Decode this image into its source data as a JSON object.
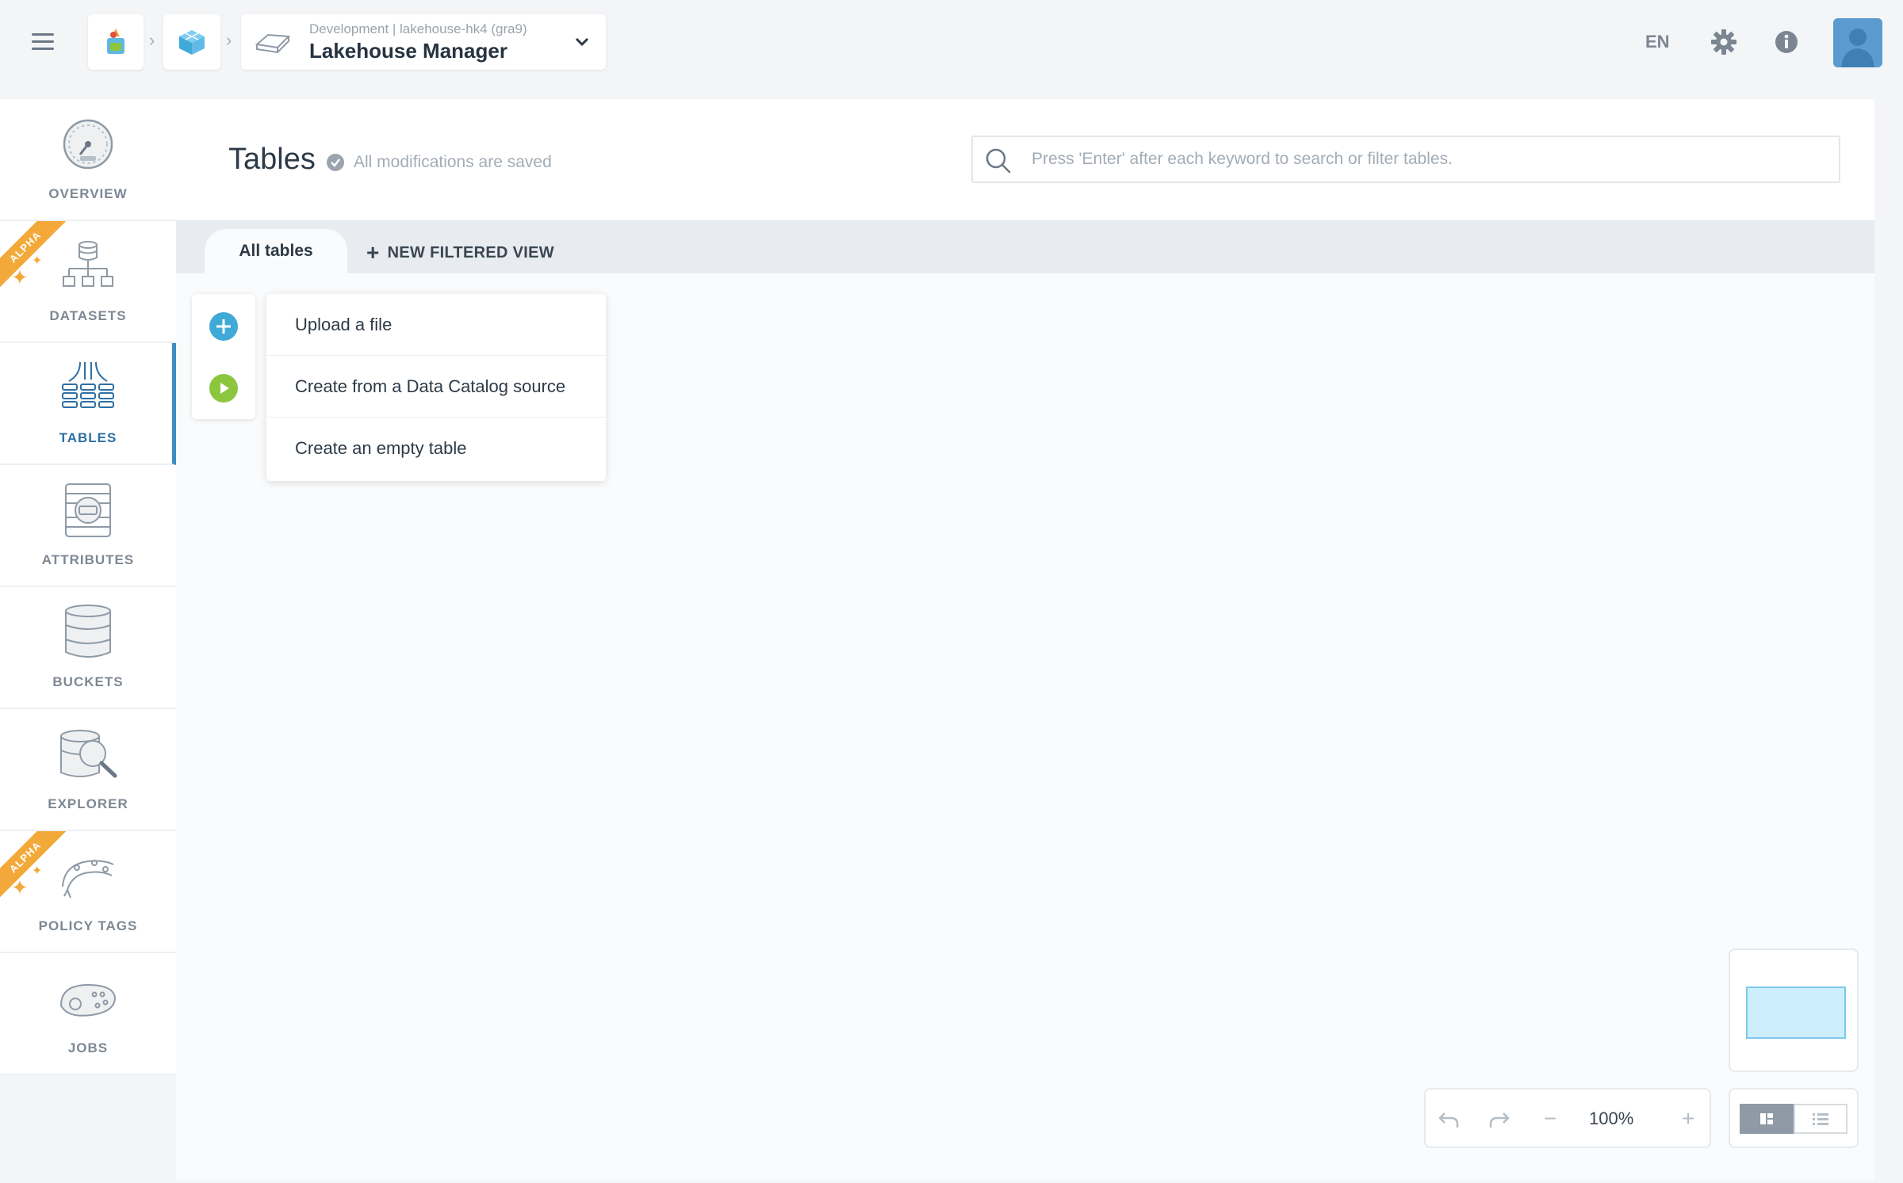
{
  "topbar": {
    "project_subtitle": "Development | lakehouse-hk4 (gra9)",
    "project_title": "Lakehouse Manager",
    "language": "EN"
  },
  "sidebar": {
    "items": [
      {
        "label": "OVERVIEW",
        "icon": "speedometer-icon",
        "alpha": false
      },
      {
        "label": "DATASETS",
        "icon": "dataset-tree-icon",
        "alpha": true
      },
      {
        "label": "TABLES",
        "icon": "tables-icon",
        "alpha": false,
        "active": true
      },
      {
        "label": "ATTRIBUTES",
        "icon": "attributes-icon",
        "alpha": false
      },
      {
        "label": "BUCKETS",
        "icon": "buckets-icon",
        "alpha": false
      },
      {
        "label": "EXPLORER",
        "icon": "explorer-icon",
        "alpha": false
      },
      {
        "label": "POLICY TAGS",
        "icon": "policy-tags-icon",
        "alpha": true
      },
      {
        "label": "JOBS",
        "icon": "jobs-icon",
        "alpha": false
      }
    ],
    "alpha_label": "ALPHA"
  },
  "main": {
    "title": "Tables",
    "saved_status": "All modifications are saved",
    "search_placeholder": "Press 'Enter' after each keyword to search or filter tables.",
    "tabs": {
      "all_tables": "All tables",
      "new_filtered_view": "NEW FILTERED VIEW"
    },
    "menu": [
      "Upload a file",
      "Create from a Data Catalog source",
      "Create an empty table"
    ],
    "zoom_level": "100%"
  },
  "colors": {
    "accent": "#3d8cc4",
    "alpha": "#f3a93a",
    "add_button": "#3fa9d8",
    "play_button": "#8cc63f"
  }
}
